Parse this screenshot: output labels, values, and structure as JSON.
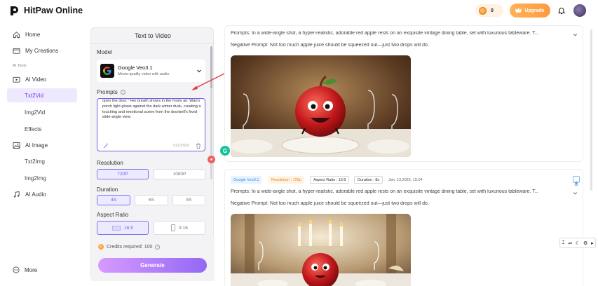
{
  "app": {
    "name": "HitPaw Online"
  },
  "header": {
    "credits": "0",
    "upgrade_label": "Upgrade"
  },
  "sidebar": {
    "home": "Home",
    "my_creations": "My Creations",
    "section_label": "AI Tools",
    "ai_video": "AI Video",
    "txt2vid": "Txt2Vid",
    "img2vid": "Img2Vid",
    "effects": "Effects",
    "ai_image": "AI Image",
    "txt2img": "Txt2Img",
    "img2img": "Img2Img",
    "ai_audio": "AI Audio",
    "more": "More"
  },
  "panel": {
    "title": "Text to Video",
    "model_label": "Model",
    "model_name": "Google Veo3.1",
    "model_desc": "Movie-quality video with audio",
    "prompts_label": "Prompts",
    "prompt_text": "open the door.\" Her breath shows in the frosty air. Warm porch light glows against the dark winter dusk, creating a touching and emotional scene from the doorbell's fixed wide-angle view.",
    "prompt_count": "911/2500",
    "resolution_label": "Resolution",
    "res_720": "720P",
    "res_1080": "1080P",
    "duration_label": "Duration",
    "dur_4": "4S",
    "dur_6": "6S",
    "dur_8": "8S",
    "aspect_label": "Aspect Ratio",
    "ar_169": "16:9",
    "ar_916": "9:16",
    "credits_required": "Credits required: 100",
    "generate": "Generate"
  },
  "results": [
    {
      "prompt": "Prompts: In a wide-angle shot, a hyper-realistic, adorable red apple rests on an exquisite vintage dining table, set with luxurious tableware. T...",
      "negative": "Negative Prompt: Not too much apple juice should be squeezed out—just two drops will do."
    },
    {
      "tags": {
        "model": "Google Veo3.1",
        "resolution": "Resolution : 720p",
        "aspect": "Aspect Ratio : 16:9",
        "duration": "Duration : 8s",
        "date": "Jan, 13,2026, 15:04"
      },
      "prompt": "Prompts: In a wide-angle shot, a hyper-realistic, adorable red apple rests on an exquisite vintage dining table, set with luxurious tableware. T...",
      "negative": "Negative Prompt: Not too much apple juice should be squeezed out—just two drops will do."
    }
  ],
  "badges": {
    "grammarly": "G"
  },
  "icons": [
    "logo-icon",
    "home-icon",
    "folder-icon",
    "video-icon",
    "image-icon",
    "music-icon",
    "more-icon",
    "bell-icon",
    "coin-icon",
    "crown-icon",
    "chevron-down-icon",
    "help-icon",
    "wand-icon",
    "trash-icon",
    "download-icon"
  ]
}
